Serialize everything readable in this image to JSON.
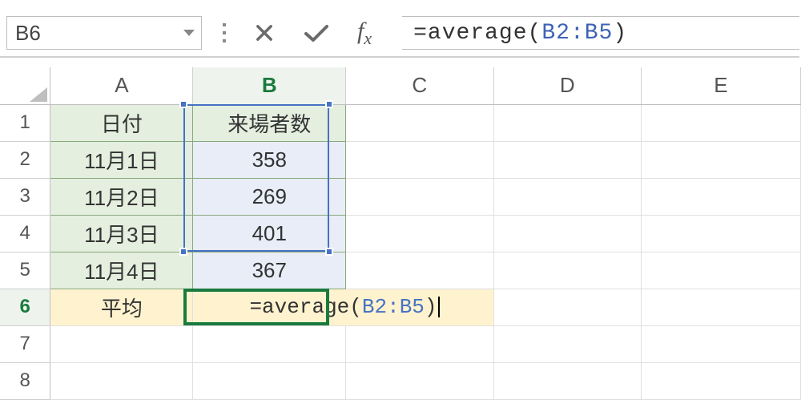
{
  "name_box": "B6",
  "formula_prefix": "=average(",
  "formula_ref": "B2:B5",
  "formula_suffix": ")",
  "columns": [
    "A",
    "B",
    "C",
    "D",
    "E"
  ],
  "rows": [
    "1",
    "2",
    "3",
    "4",
    "5",
    "6",
    "7",
    "8"
  ],
  "cells": {
    "A1": "日付",
    "B1": "来場者数",
    "A2": "11月1日",
    "B2": "358",
    "A3": "11月2日",
    "B3": "269",
    "A4": "11月3日",
    "B4": "401",
    "A5": "11月4日",
    "B5": "367",
    "A6": "平均"
  },
  "chart_data": {
    "type": "table",
    "title": "来場者数",
    "columns": [
      "日付",
      "来場者数"
    ],
    "rows": [
      [
        "11月1日",
        358
      ],
      [
        "11月2日",
        269
      ],
      [
        "11月3日",
        401
      ],
      [
        "11月4日",
        367
      ]
    ],
    "summary": {
      "label": "平均",
      "formula": "=average(B2:B5)"
    }
  }
}
